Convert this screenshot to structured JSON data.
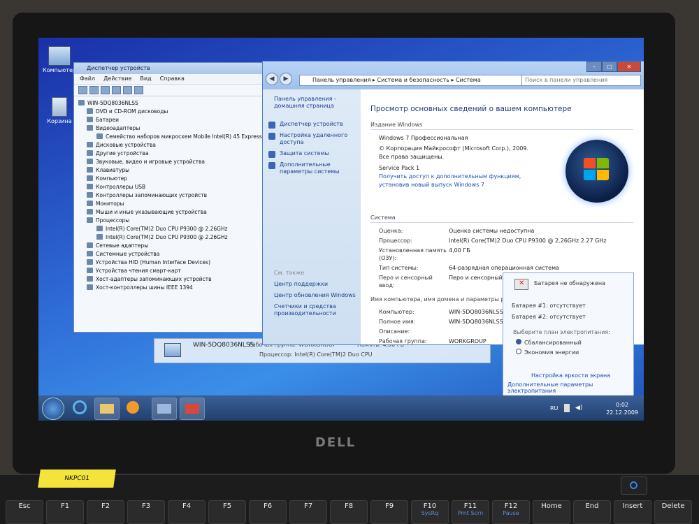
{
  "desktop": {
    "icons": [
      {
        "label": "Компьютер"
      },
      {
        "label": "Корзина"
      }
    ]
  },
  "device_manager": {
    "title": "Диспетчер устройств",
    "menu": [
      "Файл",
      "Действие",
      "Вид",
      "Справка"
    ],
    "root": "WIN-5DQ8036NLSS",
    "items": [
      "DVD и CD-ROM дисководы",
      "Батареи",
      "Видеоадаптеры",
      "Семейство наборов микросхем Mobile Intel(R) 45 Express (",
      "Дисковые устройства",
      "Другие устройства",
      "Звуковые, видео и игровые устройства",
      "Клавиатуры",
      "Компьютер",
      "Контроллеры USB",
      "Контроллеры запоминающих устройств",
      "Мониторы",
      "Мыши и иные указывающие устройства",
      "Процессоры",
      "Intel(R) Core(TM)2 Duo CPU      P9300  @ 2.26GHz",
      "Intel(R) Core(TM)2 Duo CPU      P9300  @ 2.26GHz",
      "Сетевые адаптеры",
      "Системные устройства",
      "Устройства HID (Human Interface Devices)",
      "Устройства чтения смарт-карт",
      "Хост-адаптеры запоминающих устройств",
      "Хост-контроллеры шины IEEE 1394"
    ]
  },
  "system": {
    "breadcrumb": [
      "Панель управления",
      "Система и безопасность",
      "Система"
    ],
    "search_placeholder": "Поиск в панели управления",
    "left": {
      "home": "Панель управления - домашняя страница",
      "links": [
        "Диспетчер устройств",
        "Настройка удаленного доступа",
        "Защита системы",
        "Дополнительные параметры системы"
      ],
      "see_also": "См. также",
      "see_links": [
        "Центр поддержки",
        "Центр обновления Windows",
        "Счетчики и средства производительности"
      ]
    },
    "heading": "Просмотр основных сведений о вашем компьютере",
    "edition_section": "Издание Windows",
    "edition": "Windows 7 Профессиональная",
    "copyright": "© Корпорация Майкрософт (Microsoft Corp.), 2009. Все права защищены.",
    "service_pack": "Service Pack 1",
    "upgrade_link": "Получить доступ к дополнительным функциям, установив новый выпуск Windows 7",
    "system_section": "Система",
    "rows": [
      {
        "k": "Оценка:",
        "v": "Оценка системы недоступна",
        "link": true
      },
      {
        "k": "Процессор:",
        "v": "Intel(R) Core(TM)2 Duo CPU    P9300  @ 2.26GHz   2.27 GHz"
      },
      {
        "k": "Установленная память (ОЗУ):",
        "v": "4,00 ГБ"
      },
      {
        "k": "Тип системы:",
        "v": "64-разрядная операционная система"
      },
      {
        "k": "Перо и сенсорный ввод:",
        "v": "Перо и сенсорный ввод недоступны для этого экрана"
      }
    ],
    "name_section": "Имя компьютера, имя домена и параметры рабо",
    "name_rows": [
      {
        "k": "Компьютер:",
        "v": "WIN-5DQ8036NLSS"
      },
      {
        "k": "Полное имя:",
        "v": "WIN-5DQ8036NLSS"
      },
      {
        "k": "Описание:",
        "v": ""
      },
      {
        "k": "Рабочая группа:",
        "v": "WORKGROUP"
      }
    ]
  },
  "strip": {
    "name": "WIN-5DQ8036NLSS",
    "group": "Рабочая группа: WORKGROUP",
    "memory": "Память: 4,00 ГБ",
    "cpu": "Процессор: Intel(R) Core(TM)2 Duo CPU"
  },
  "battery": {
    "title": "Батарея не обнаружена",
    "b1": "Батарея #1: отсутствует",
    "b2": "Батарея #2: отсутствует",
    "choose": "Выберите план электропитания:",
    "plan1": "Сбалансированный",
    "plan2": "Экономия энергии",
    "link1": "Настройка яркости экрана",
    "link2": "Дополнительные параметры электропитания"
  },
  "taskbar": {
    "lang": "RU",
    "time": "0:02",
    "date": "22.12.2009"
  },
  "laptop": {
    "brand": "DELL",
    "sticker": "NKPC01",
    "keys": [
      {
        "a": "Esc",
        "b": ""
      },
      {
        "a": "F1",
        "b": ""
      },
      {
        "a": "F2",
        "b": ""
      },
      {
        "a": "F3",
        "b": ""
      },
      {
        "a": "F4",
        "b": ""
      },
      {
        "a": "F5",
        "b": ""
      },
      {
        "a": "F6",
        "b": ""
      },
      {
        "a": "F7",
        "b": ""
      },
      {
        "a": "F8",
        "b": ""
      },
      {
        "a": "F9",
        "b": ""
      },
      {
        "a": "F10",
        "b": "SysRq"
      },
      {
        "a": "F11",
        "b": "Prnt Scrn"
      },
      {
        "a": "F12",
        "b": "Pause"
      },
      {
        "a": "Home",
        "b": ""
      },
      {
        "a": "End",
        "b": ""
      },
      {
        "a": "Insert",
        "b": ""
      },
      {
        "a": "Delete",
        "b": ""
      }
    ]
  }
}
